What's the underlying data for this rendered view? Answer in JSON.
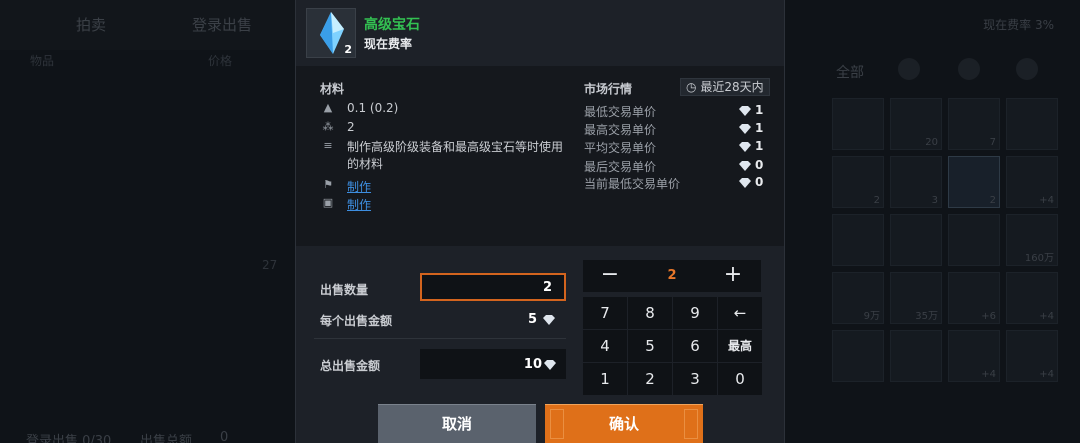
{
  "background": {
    "tabs": [
      "拍卖",
      "登录出售"
    ],
    "subheaders": [
      "物品",
      "价格"
    ],
    "current_rate": "现在费率 3%",
    "category_all": "全部",
    "cell_labels": [
      "20",
      "7",
      "2",
      "3",
      "2",
      "+4",
      "160万",
      "9万",
      "35万",
      "+6",
      "+4",
      "+4",
      "+4"
    ],
    "mid_text": "27",
    "bottom_text": "登录出售 0/30",
    "bottom_text2": "出售总额",
    "bottom_count": "0"
  },
  "dialog": {
    "item": {
      "name": "高级宝石",
      "count": "2",
      "subtitle": "现在费率"
    },
    "material": {
      "title": "材料",
      "weight": "0.1 (0.2)",
      "stack": "2",
      "description": "制作高级阶级装备和最高级宝石等时使用的材料",
      "link1": "制作",
      "link2": "制作"
    },
    "market": {
      "title": "市场行情",
      "period": "最近28天内",
      "rows": [
        {
          "label": "最低交易单价",
          "value": "1"
        },
        {
          "label": "最高交易单价",
          "value": "1"
        },
        {
          "label": "平均交易单价",
          "value": "1"
        },
        {
          "label": "最后交易单价",
          "value": "0"
        },
        {
          "label": "当前最低交易单价",
          "value": "0"
        }
      ]
    },
    "sale": {
      "qty_label": "出售数量",
      "qty_value": "2",
      "unit_price_label": "每个出售金额",
      "unit_price_value": "5",
      "total_label": "总出售金额",
      "total_value": "10"
    },
    "keypad": {
      "minus": "−",
      "value": "2",
      "plus": "+",
      "keys": [
        "7",
        "8",
        "9",
        "←",
        "4",
        "5",
        "6",
        "最高",
        "1",
        "2",
        "3",
        "0"
      ]
    },
    "buttons": {
      "cancel": "取消",
      "confirm": "确认"
    }
  },
  "colors": {
    "item_name": "#33c152",
    "accent": "#df7019",
    "link": "#3d8ee0"
  }
}
